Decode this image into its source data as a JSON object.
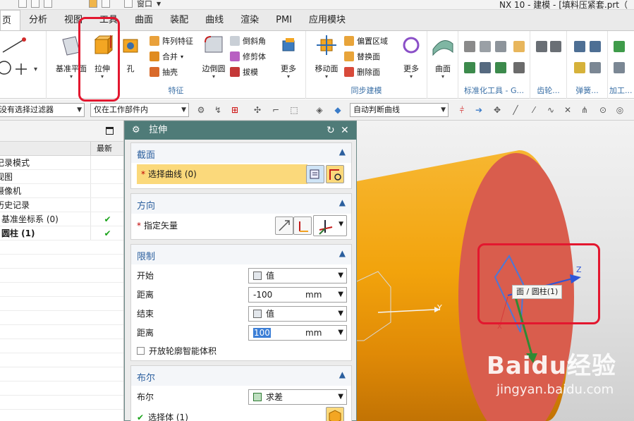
{
  "window": {
    "title": "NX 10 - 建模 - [填料压紧套.prt（",
    "window_menu": "窗口"
  },
  "tabs": [
    "页",
    "分析",
    "视图",
    "工具",
    "曲面",
    "装配",
    "曲线",
    "渲染",
    "PMI",
    "应用模块"
  ],
  "ribbon": {
    "datum_plane": "基准平面",
    "extrude": "拉伸",
    "hole": "孔",
    "pattern_feature": "阵列特征",
    "unite": "合并",
    "shell": "抽壳",
    "edge_blend": "边倒圆",
    "chamfer": "倒斜角",
    "trim_body": "修剪体",
    "draft": "拔模",
    "more1": "更多",
    "feature_group": "特征",
    "move_face": "移动面",
    "offset_region": "偏置区域",
    "replace_face": "替换面",
    "delete_face": "删除面",
    "more2": "更多",
    "sync_group": "同步建模",
    "surface": "曲面",
    "std_tools_group": "标准化工具 - G...",
    "gear_group": "齿轮...",
    "spring_group": "弹簧...",
    "machining_group": "加工..."
  },
  "filterbar": {
    "type_filter": "没有选择过滤器",
    "scope": "仅在工作部件内",
    "curve_rule": "自动判断曲线"
  },
  "navigator": {
    "col_latest": "最新",
    "rows": [
      {
        "label": "记录模式",
        "check": ""
      },
      {
        "label": "视图",
        "check": ""
      },
      {
        "label": "摄像机",
        "check": ""
      },
      {
        "label": "历史记录",
        "check": ""
      },
      {
        "label": "基准坐标系 (0)",
        "check": "✔"
      },
      {
        "label": "圆柱 (1)",
        "check": "✔"
      }
    ]
  },
  "dialog": {
    "title": "拉伸",
    "section": {
      "title": "截面",
      "select_curve": "选择曲线 (0)"
    },
    "direction": {
      "title": "方向",
      "specify_vector": "指定矢量"
    },
    "limits": {
      "title": "限制",
      "start_label": "开始",
      "start_value": "值",
      "start_dist_label": "距离",
      "start_dist": "-100",
      "start_unit": "mm",
      "end_label": "结束",
      "end_value": "值",
      "end_dist_label": "距离",
      "end_dist": "100",
      "end_unit": "mm",
      "open_profile": "开放轮廓智能体积"
    },
    "boolean": {
      "title": "布尔",
      "label": "布尔",
      "value": "求差",
      "select_body": "选择体 (1)"
    }
  },
  "viewport": {
    "tooltip": "面 / 圆柱(1)",
    "axis_y": "Y",
    "axis_z": "Z",
    "axis_x": "X",
    "watermark_line1": "Baidu经验",
    "watermark_line2": "jingyan.baidu.com"
  },
  "colors": {
    "cylinder": "#f2a30c",
    "cap_face": "#d95d4d",
    "dialog_title": "#4f7b78",
    "highlight": "#fbd97b",
    "annotation_red": "#e3172f"
  }
}
